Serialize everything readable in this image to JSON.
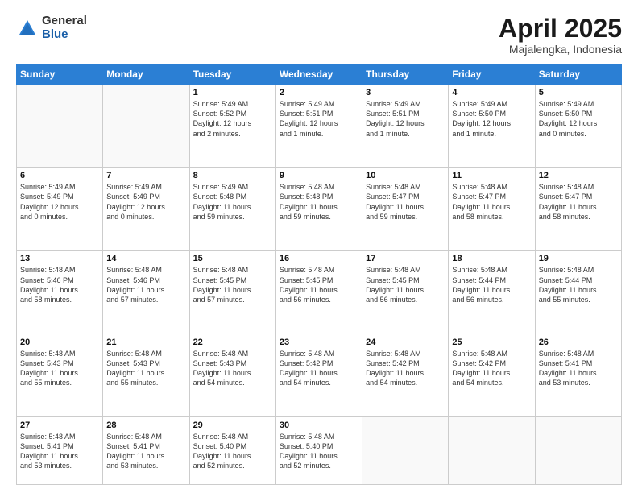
{
  "logo": {
    "general": "General",
    "blue": "Blue"
  },
  "title": {
    "month": "April 2025",
    "location": "Majalengka, Indonesia"
  },
  "weekdays": [
    "Sunday",
    "Monday",
    "Tuesday",
    "Wednesday",
    "Thursday",
    "Friday",
    "Saturday"
  ],
  "weeks": [
    [
      {
        "day": "",
        "info": ""
      },
      {
        "day": "",
        "info": ""
      },
      {
        "day": "1",
        "info": "Sunrise: 5:49 AM\nSunset: 5:52 PM\nDaylight: 12 hours\nand 2 minutes."
      },
      {
        "day": "2",
        "info": "Sunrise: 5:49 AM\nSunset: 5:51 PM\nDaylight: 12 hours\nand 1 minute."
      },
      {
        "day": "3",
        "info": "Sunrise: 5:49 AM\nSunset: 5:51 PM\nDaylight: 12 hours\nand 1 minute."
      },
      {
        "day": "4",
        "info": "Sunrise: 5:49 AM\nSunset: 5:50 PM\nDaylight: 12 hours\nand 1 minute."
      },
      {
        "day": "5",
        "info": "Sunrise: 5:49 AM\nSunset: 5:50 PM\nDaylight: 12 hours\nand 0 minutes."
      }
    ],
    [
      {
        "day": "6",
        "info": "Sunrise: 5:49 AM\nSunset: 5:49 PM\nDaylight: 12 hours\nand 0 minutes."
      },
      {
        "day": "7",
        "info": "Sunrise: 5:49 AM\nSunset: 5:49 PM\nDaylight: 12 hours\nand 0 minutes."
      },
      {
        "day": "8",
        "info": "Sunrise: 5:49 AM\nSunset: 5:48 PM\nDaylight: 11 hours\nand 59 minutes."
      },
      {
        "day": "9",
        "info": "Sunrise: 5:48 AM\nSunset: 5:48 PM\nDaylight: 11 hours\nand 59 minutes."
      },
      {
        "day": "10",
        "info": "Sunrise: 5:48 AM\nSunset: 5:47 PM\nDaylight: 11 hours\nand 59 minutes."
      },
      {
        "day": "11",
        "info": "Sunrise: 5:48 AM\nSunset: 5:47 PM\nDaylight: 11 hours\nand 58 minutes."
      },
      {
        "day": "12",
        "info": "Sunrise: 5:48 AM\nSunset: 5:47 PM\nDaylight: 11 hours\nand 58 minutes."
      }
    ],
    [
      {
        "day": "13",
        "info": "Sunrise: 5:48 AM\nSunset: 5:46 PM\nDaylight: 11 hours\nand 58 minutes."
      },
      {
        "day": "14",
        "info": "Sunrise: 5:48 AM\nSunset: 5:46 PM\nDaylight: 11 hours\nand 57 minutes."
      },
      {
        "day": "15",
        "info": "Sunrise: 5:48 AM\nSunset: 5:45 PM\nDaylight: 11 hours\nand 57 minutes."
      },
      {
        "day": "16",
        "info": "Sunrise: 5:48 AM\nSunset: 5:45 PM\nDaylight: 11 hours\nand 56 minutes."
      },
      {
        "day": "17",
        "info": "Sunrise: 5:48 AM\nSunset: 5:45 PM\nDaylight: 11 hours\nand 56 minutes."
      },
      {
        "day": "18",
        "info": "Sunrise: 5:48 AM\nSunset: 5:44 PM\nDaylight: 11 hours\nand 56 minutes."
      },
      {
        "day": "19",
        "info": "Sunrise: 5:48 AM\nSunset: 5:44 PM\nDaylight: 11 hours\nand 55 minutes."
      }
    ],
    [
      {
        "day": "20",
        "info": "Sunrise: 5:48 AM\nSunset: 5:43 PM\nDaylight: 11 hours\nand 55 minutes."
      },
      {
        "day": "21",
        "info": "Sunrise: 5:48 AM\nSunset: 5:43 PM\nDaylight: 11 hours\nand 55 minutes."
      },
      {
        "day": "22",
        "info": "Sunrise: 5:48 AM\nSunset: 5:43 PM\nDaylight: 11 hours\nand 54 minutes."
      },
      {
        "day": "23",
        "info": "Sunrise: 5:48 AM\nSunset: 5:42 PM\nDaylight: 11 hours\nand 54 minutes."
      },
      {
        "day": "24",
        "info": "Sunrise: 5:48 AM\nSunset: 5:42 PM\nDaylight: 11 hours\nand 54 minutes."
      },
      {
        "day": "25",
        "info": "Sunrise: 5:48 AM\nSunset: 5:42 PM\nDaylight: 11 hours\nand 54 minutes."
      },
      {
        "day": "26",
        "info": "Sunrise: 5:48 AM\nSunset: 5:41 PM\nDaylight: 11 hours\nand 53 minutes."
      }
    ],
    [
      {
        "day": "27",
        "info": "Sunrise: 5:48 AM\nSunset: 5:41 PM\nDaylight: 11 hours\nand 53 minutes."
      },
      {
        "day": "28",
        "info": "Sunrise: 5:48 AM\nSunset: 5:41 PM\nDaylight: 11 hours\nand 53 minutes."
      },
      {
        "day": "29",
        "info": "Sunrise: 5:48 AM\nSunset: 5:40 PM\nDaylight: 11 hours\nand 52 minutes."
      },
      {
        "day": "30",
        "info": "Sunrise: 5:48 AM\nSunset: 5:40 PM\nDaylight: 11 hours\nand 52 minutes."
      },
      {
        "day": "",
        "info": ""
      },
      {
        "day": "",
        "info": ""
      },
      {
        "day": "",
        "info": ""
      }
    ]
  ]
}
